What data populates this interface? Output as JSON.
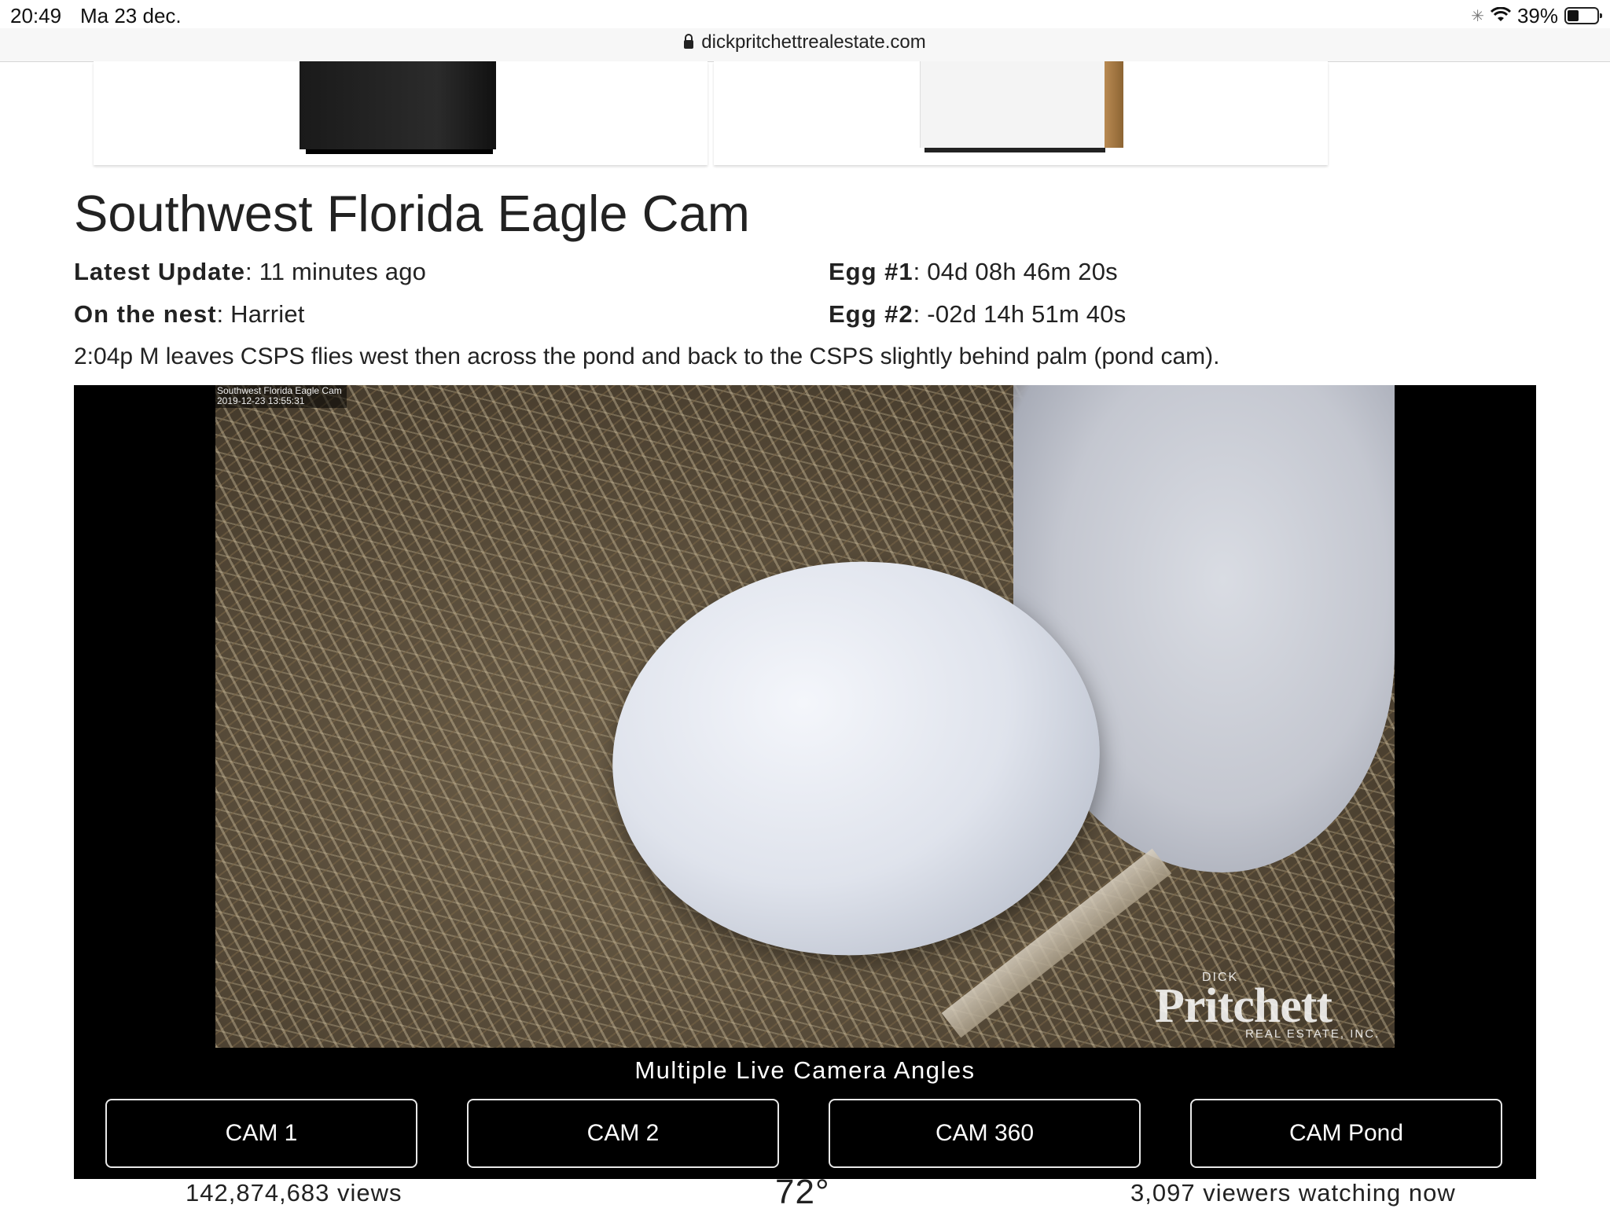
{
  "status_bar": {
    "time": "20:49",
    "date": "Ma 23 dec.",
    "battery": "39%",
    "battery_level": 0.39
  },
  "browser": {
    "url": "dickpritchettrealestate.com"
  },
  "page": {
    "title": "Southwest Florida Eagle Cam",
    "latest_update_label": "Latest Update",
    "latest_update_value": "11 minutes ago",
    "on_nest_label": "On the nest",
    "on_nest_value": "Harriet",
    "egg1_label": "Egg #1",
    "egg1_value": "04d 08h 46m 20s",
    "egg2_label": "Egg #2",
    "egg2_value": "-02d 14h 51m 40s",
    "note": "2:04p M leaves CSPS flies west then across the pond and back to the CSPS slightly behind palm (pond cam)."
  },
  "video": {
    "overlay_title": "Southwest Florida Eagle Cam",
    "overlay_timestamp": "2019-12-23 13:55:31",
    "logo_small": "DICK",
    "logo_main": "Pritchett",
    "logo_sub": "REAL ESTATE, INC.",
    "angles_heading": "Multiple Live Camera Angles",
    "cam_buttons": [
      "CAM 1",
      "CAM 2",
      "CAM 360",
      "CAM Pond"
    ]
  },
  "stats": {
    "views": "142,874,683 views",
    "temperature": "72°",
    "viewers": "3,097 viewers watching now"
  }
}
